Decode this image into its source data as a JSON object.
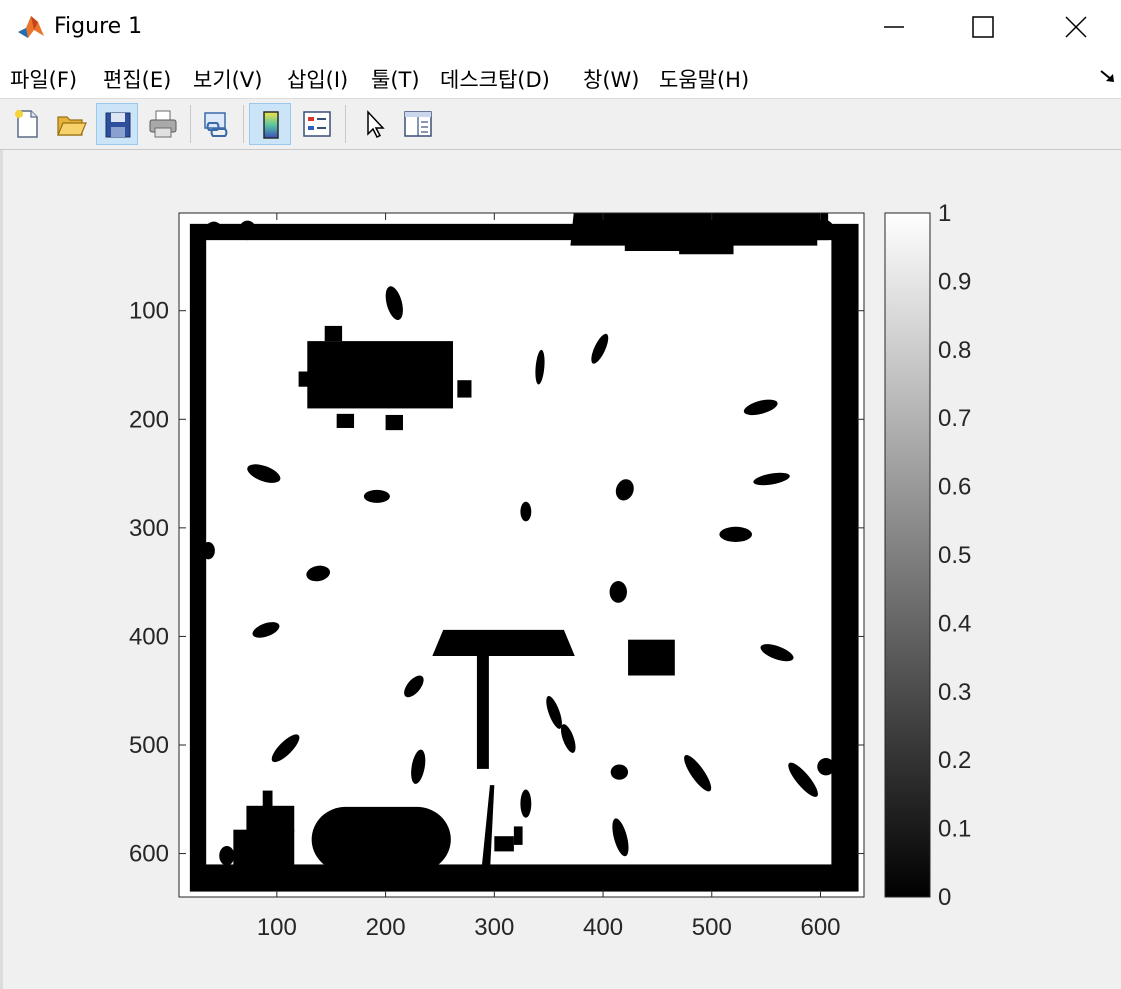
{
  "window": {
    "title": "Figure 1",
    "icon": "matlab-icon",
    "controls": [
      "minimize-icon",
      "maximize-icon",
      "close-icon"
    ]
  },
  "menu": {
    "items": [
      {
        "label": "파일(F)"
      },
      {
        "label": "편집(E)"
      },
      {
        "label": "보기(V)"
      },
      {
        "label": "삽입(I)"
      },
      {
        "label": "툴(T)"
      },
      {
        "label": "데스크탑(D)"
      },
      {
        "label": "창(W)"
      },
      {
        "label": "도움말(H)"
      }
    ],
    "dock_icon": "dock-arrow-icon"
  },
  "toolbar": {
    "buttons": [
      {
        "icon": "new-figure-icon",
        "pressed": false
      },
      {
        "icon": "open-file-icon",
        "pressed": false
      },
      {
        "icon": "save-icon",
        "pressed": true
      },
      {
        "icon": "print-icon",
        "pressed": false
      },
      {
        "icon": "link-plot-icon",
        "pressed": false
      },
      {
        "icon": "colorbar-icon",
        "pressed": true
      },
      {
        "icon": "legend-icon",
        "pressed": false
      },
      {
        "icon": "edit-plot-icon",
        "pressed": false
      },
      {
        "icon": "property-inspector-icon",
        "pressed": false
      }
    ]
  },
  "chart_data": {
    "type": "heatmap",
    "colormap": "gray",
    "x_ticks": [
      100,
      200,
      300,
      400,
      500,
      600
    ],
    "y_ticks": [
      100,
      200,
      300,
      400,
      500,
      600
    ],
    "xlim": [
      10,
      640
    ],
    "ylim": [
      10,
      640
    ],
    "y_direction": "reverse",
    "colorbar": {
      "ticks": [
        0,
        0.1,
        0.2,
        0.3,
        0.4,
        0.5,
        0.6,
        0.7,
        0.8,
        0.9,
        1
      ],
      "tick_labels": [
        "0",
        "0.1",
        "0.2",
        "0.3",
        "0.4",
        "0.5",
        "0.6",
        "0.7",
        "0.8",
        "0.9",
        "1"
      ],
      "range": [
        0,
        1
      ],
      "location": "right"
    },
    "walls": {
      "outer": [
        20,
        635
      ],
      "inner": [
        35,
        610
      ],
      "value": 0
    },
    "grid": false
  }
}
